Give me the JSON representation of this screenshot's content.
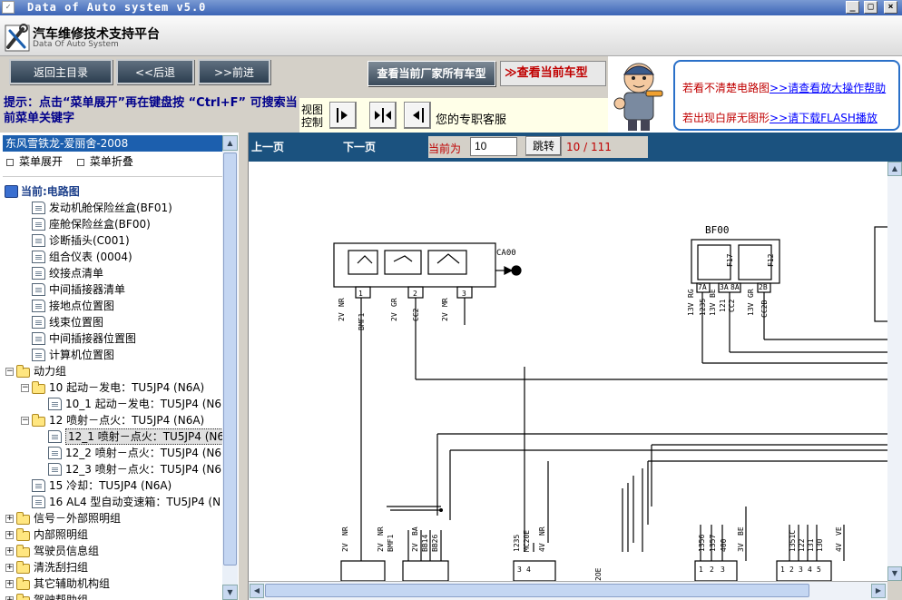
{
  "window": {
    "title": "Data of Auto system v5.0"
  },
  "app": {
    "title": "汽车维修技术支持平台",
    "subtitle": "Data Of Auto System"
  },
  "nav": {
    "home": "返回主目录",
    "back": "<<后退",
    "forward": ">>前进",
    "all_models": "查看当前厂家所有车型",
    "current_model": "≫查看当前车型"
  },
  "ad": {
    "line1_text": "若看不清楚电路图",
    "line1_link": ">>请查看放大操作帮助",
    "line2_text": "若出现白屏无图形",
    "line2_link": ">>请下载FLASH播放"
  },
  "hint": {
    "text": "提示：点击“菜单展开”再在键盘按 “Ctrl+F” 可搜索当前菜单关键字"
  },
  "view_control": {
    "label": "视图控制",
    "assistant": "您的专职客服"
  },
  "sidebar": {
    "vehicle": "东风雪铁龙-爱丽舍-2008",
    "expand": "菜单展开",
    "collapse": "菜单折叠",
    "current": "当前:电路图",
    "tree": [
      {
        "label": "发动机舱保险丝盒(BF01)",
        "type": "doc",
        "level": 1
      },
      {
        "label": "座舱保险丝盒(BF00)",
        "type": "doc",
        "level": 1
      },
      {
        "label": "诊断插头(C001)",
        "type": "doc",
        "level": 1
      },
      {
        "label": "组合仪表 (0004)",
        "type": "doc",
        "level": 1
      },
      {
        "label": "绞接点清单",
        "type": "doc",
        "level": 1
      },
      {
        "label": "中间插接器清单",
        "type": "doc",
        "level": 1
      },
      {
        "label": "接地点位置图",
        "type": "doc",
        "level": 1
      },
      {
        "label": "线束位置图",
        "type": "doc",
        "level": 1
      },
      {
        "label": "中间插接器位置图",
        "type": "doc",
        "level": 1
      },
      {
        "label": "计算机位置图",
        "type": "doc",
        "level": 1
      },
      {
        "label": "动力组",
        "type": "folder",
        "level": 0,
        "toggle": "−"
      },
      {
        "label": "10 起动－发电：TU5JP4 (N6A)",
        "type": "folder",
        "level": 1,
        "toggle": "−"
      },
      {
        "label": "10_1 起动－发电：TU5JP4 (N6",
        "type": "doc",
        "level": 2
      },
      {
        "label": "12 喷射－点火：TU5JP4 (N6A)",
        "type": "folder",
        "level": 1,
        "toggle": "−"
      },
      {
        "label": "12_1 喷射－点火：TU5JP4 (N6",
        "type": "doc",
        "level": 2,
        "selected": true
      },
      {
        "label": "12_2 喷射－点火：TU5JP4 (N6",
        "type": "doc",
        "level": 2
      },
      {
        "label": "12_3 喷射－点火：TU5JP4 (N6",
        "type": "doc",
        "level": 2
      },
      {
        "label": "15 冷却：TU5JP4 (N6A)",
        "type": "doc",
        "level": 1
      },
      {
        "label": "16 AL4 型自动变速箱：TU5JP4 (N",
        "type": "doc",
        "level": 1
      },
      {
        "label": "信号－外部照明组",
        "type": "folder",
        "level": 0,
        "toggle": "+"
      },
      {
        "label": "内部照明组",
        "type": "folder",
        "level": 0,
        "toggle": "+"
      },
      {
        "label": "驾驶员信息组",
        "type": "folder",
        "level": 0,
        "toggle": "+"
      },
      {
        "label": "清洗刮扫组",
        "type": "folder",
        "level": 0,
        "toggle": "+"
      },
      {
        "label": "其它辅助机构组",
        "type": "folder",
        "level": 0,
        "toggle": "+"
      },
      {
        "label": "驾驶帮助组",
        "type": "folder",
        "level": 0,
        "toggle": "+"
      }
    ]
  },
  "doc": {
    "prev": "上一页",
    "next": "下一页",
    "current_label": "当前为",
    "current_page": "10",
    "go": "跳转",
    "page_count": "10 / 111"
  },
  "diagram": {
    "labels": {
      "ca00": "CA00",
      "bf00": "BF00",
      "w1": "2V",
      "w2": "NR",
      "w3": "BMF1",
      "w4": "2V",
      "w5": "GR",
      "w6": "CC2",
      "w7": "2V",
      "w8": "MR",
      "p1": "1",
      "p2": "2",
      "p3": "3",
      "b1": "13V",
      "b2": "RG",
      "b3": "1235",
      "b4": "13V",
      "b5": "BE",
      "b6": "121",
      "b7": "CC2",
      "b8": "13V",
      "b9": "GR",
      "b10": "CC2B",
      "f1": "F17",
      "f2": "F12",
      "pa": "7A",
      "pb": "3A",
      "pc": "8A",
      "pd": "2B",
      "l1": "2V",
      "l2": "NR",
      "l3": "2V",
      "l4": "NR",
      "l5": "BMF1",
      "l6": "2V",
      "l7": "BA",
      "l8": "BB14",
      "l9": "BB26",
      "l10": "1235",
      "l11": "MC20E",
      "l12": "4V",
      "l13": "NR",
      "l14": "1356",
      "l15": "1357",
      "l16": "400",
      "l17": "3V",
      "l18": "BE",
      "l19": "1351C",
      "l20": "122",
      "l21": "131",
      "l22": "130",
      "l23": "4V",
      "l24": "VE",
      "q1": "3",
      "q2": "4",
      "q3": "1",
      "q4": "2",
      "q5": "3",
      "q6": "1",
      "q7": "2",
      "q8": "3",
      "q9": "4",
      "q10": "5",
      "q11": "2OE"
    }
  },
  "colors": {
    "header_blue": "#1b527f",
    "tree_select": "#1c5fae",
    "red": "#c00000",
    "link": "#0000ff"
  }
}
